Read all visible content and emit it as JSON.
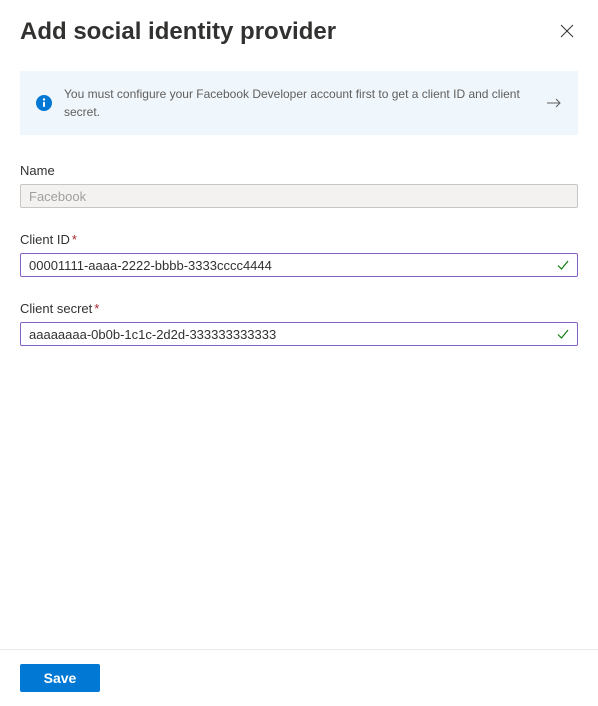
{
  "header": {
    "title": "Add social identity provider"
  },
  "banner": {
    "text": "You must configure your Facebook Developer account first to get a client ID and client secret."
  },
  "form": {
    "name": {
      "label": "Name",
      "value": "Facebook",
      "required": false,
      "readonly": true
    },
    "clientId": {
      "label": "Client ID",
      "value": "00001111-aaaa-2222-bbbb-3333cccc4444",
      "required": true,
      "valid": true
    },
    "clientSecret": {
      "label": "Client secret",
      "value": "aaaaaaaa-0b0b-1c1c-2d2d-333333333333",
      "required": true,
      "valid": true
    }
  },
  "footer": {
    "save_label": "Save"
  }
}
